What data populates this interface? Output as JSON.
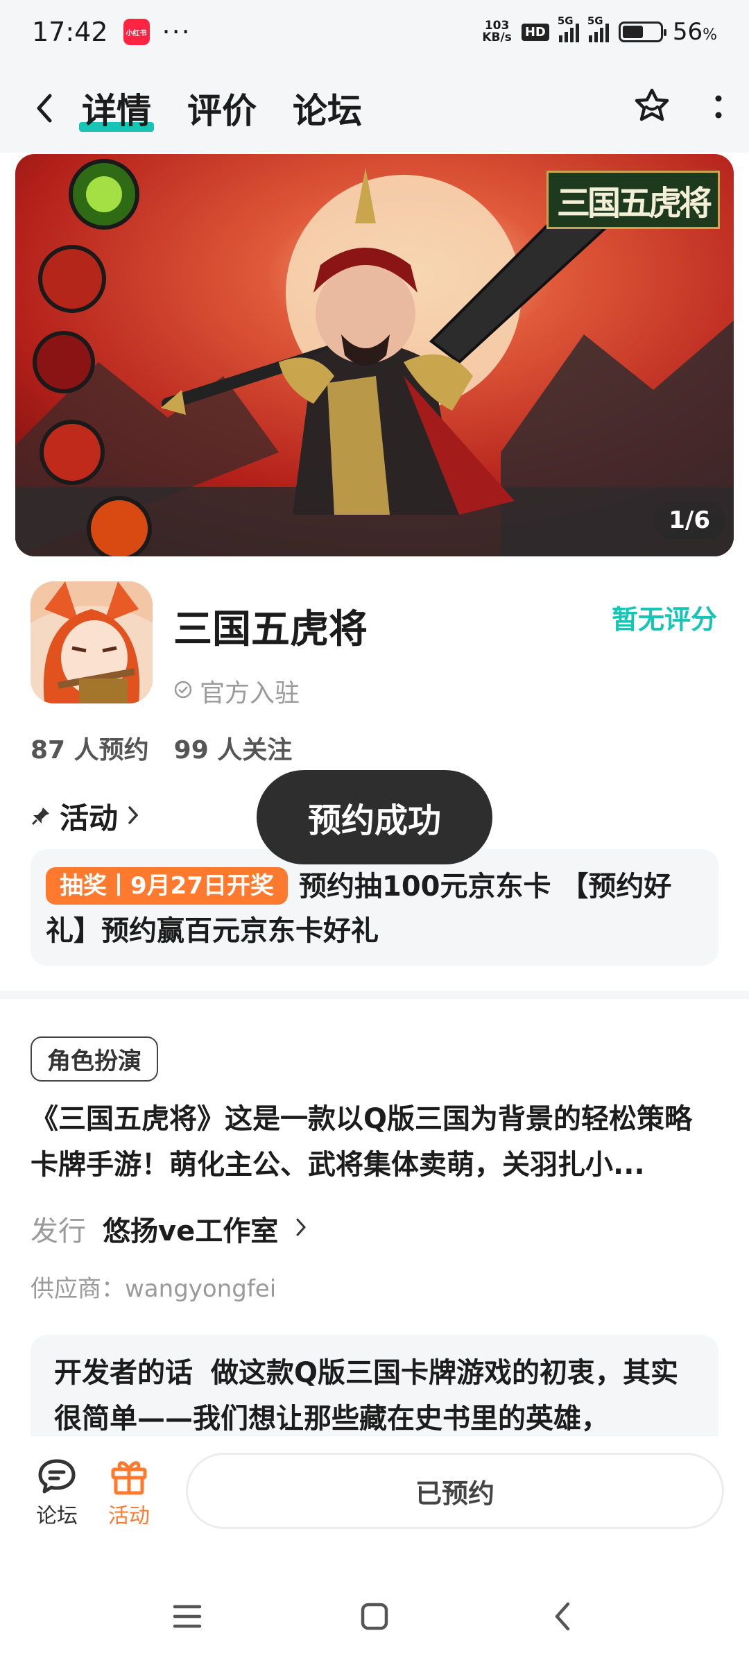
{
  "status_bar": {
    "time": "17:42",
    "app_badge": "小红书",
    "more": "···",
    "net_speed_value": "103",
    "net_speed_unit": "KB/s",
    "hd": "HD",
    "signal1": "5G",
    "signal2": "5G",
    "battery_percent": "56",
    "battery_unit": "%",
    "battery_level": 0.56
  },
  "header": {
    "tabs": [
      {
        "label": "详情",
        "active": true
      },
      {
        "label": "评价",
        "active": false
      },
      {
        "label": "论坛",
        "active": false
      }
    ]
  },
  "banner": {
    "title_art": "三国五虎将",
    "page_indicator": "1/6"
  },
  "app": {
    "name": "三国五虎将",
    "rating": "暂无评分",
    "official": "官方入驻",
    "reservations": "87 人预约",
    "followers": "99 人关注"
  },
  "activity": {
    "heading": "活动",
    "tag": "抽奖丨9月27日开奖",
    "text": "预约抽100元京东卡 【预约好礼】预约赢百元京东卡好礼"
  },
  "toast": "预约成功",
  "details": {
    "genre": "角色扮演",
    "description": "《三国五虎将》这是一款以Q版三国为背景的轻松策略卡牌手游！萌化主公、武将集体卖萌，关羽扎小...",
    "publisher_label": "发行",
    "publisher": "悠扬ve工作室",
    "supplier": "供应商：wangyongfei",
    "dev_label": "开发者的话",
    "dev_text": "做这款Q版三国卡牌游戏的初衷，其实很简单——我们想让那些藏在史书里的英雄，"
  },
  "bottom_bar": {
    "forum": "论坛",
    "activity": "活动",
    "reserved": "已预约"
  },
  "colors": {
    "accent_teal": "#17c4b5",
    "accent_orange": "#ff7a2e",
    "toast_bg": "#2e2e2e"
  },
  "icons": [
    "back-icon",
    "star-badge-icon",
    "more-vertical-icon",
    "pin-icon",
    "chevron-right-icon",
    "check-circle-icon",
    "forum-icon",
    "gift-icon",
    "menu-icon",
    "home-square-icon",
    "nav-back-icon"
  ]
}
